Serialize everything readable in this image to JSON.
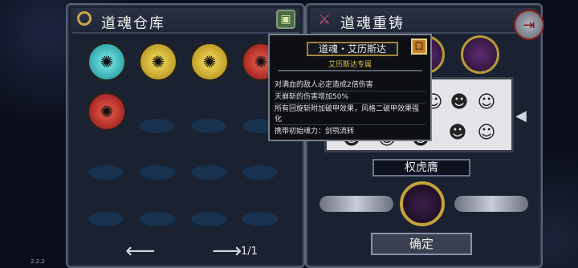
{
  "left_panel": {
    "title": "道魂仓库",
    "header_icon": "ring-icon",
    "header_button_icon": "box-icon",
    "owned_souls": [
      {
        "color": "#1fb3b6",
        "icon": "teal-soul-icon"
      },
      {
        "color": "#d6b21a",
        "icon": "gold-soul-icon"
      },
      {
        "color": "#d6b21a",
        "icon": "gold-soul-icon"
      },
      {
        "color": "#c0201e",
        "icon": "red-soul-icon"
      },
      {
        "color": "#c0201e",
        "icon": "red-soul-icon"
      }
    ],
    "pager": "1/1",
    "prev_icon": "arrow-left-icon",
    "next_icon": "arrow-right-icon"
  },
  "right_panel": {
    "title": "道魂重铸",
    "sword_icon": "sword-icon",
    "exit_icon": "exit-icon",
    "selected_name": "权虎膺",
    "confirm_label": "确定"
  },
  "tooltip": {
    "title": "道魂・艾历斯达",
    "subtitle": "艾历斯达专属",
    "lines": [
      "对满血的敌人必定造成2倍伤害",
      "天崩斩的伤害增加50%",
      "所有回旋斩附加破甲效果，风格二破甲效果强化",
      "携带初始魂力：剑鸮流转"
    ]
  },
  "version": "2.2.2"
}
